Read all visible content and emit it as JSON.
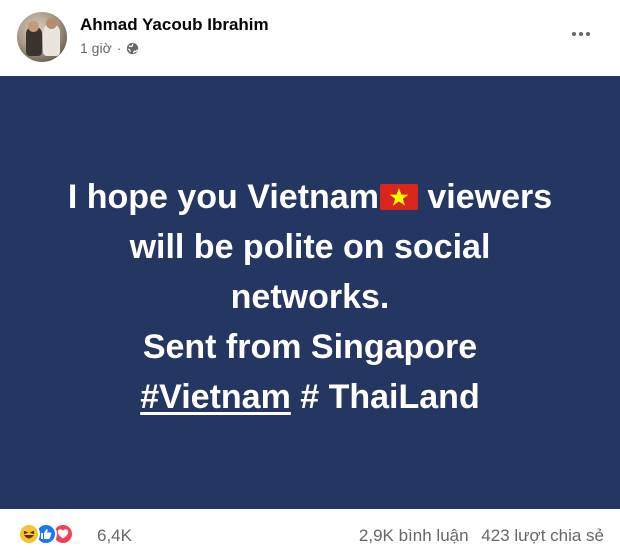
{
  "post": {
    "author": "Ahmad Yacoub Ibrahim",
    "time": "1 giờ",
    "separator": "·",
    "privacy_icon": "globe-icon",
    "more_icon": "more-options-icon"
  },
  "card": {
    "background": "#243762",
    "text_color": "#ffffff",
    "line1_prefix": "I hope you Vietnam",
    "line1_suffix": " viewers",
    "flag_icon": "vietnam-flag-icon",
    "line2": "will be polite on social",
    "line3": "networks.",
    "line4": "Sent from Singapore",
    "hashtag": "#Vietnam",
    "line5_rest": " # ThaiLand"
  },
  "footer": {
    "reaction_icons": [
      "haha-icon",
      "like-icon",
      "love-icon"
    ],
    "reaction_count": "6,4K",
    "comments": "2,9K bình luận",
    "shares": "423 lượt chia sẻ"
  },
  "colors": {
    "card": "#243762",
    "meta_text": "#65676b",
    "like": "#1877f2",
    "love": "#f33e58",
    "haha": "#f7c232",
    "flag_red": "#da251d",
    "flag_star": "#ffff00"
  }
}
